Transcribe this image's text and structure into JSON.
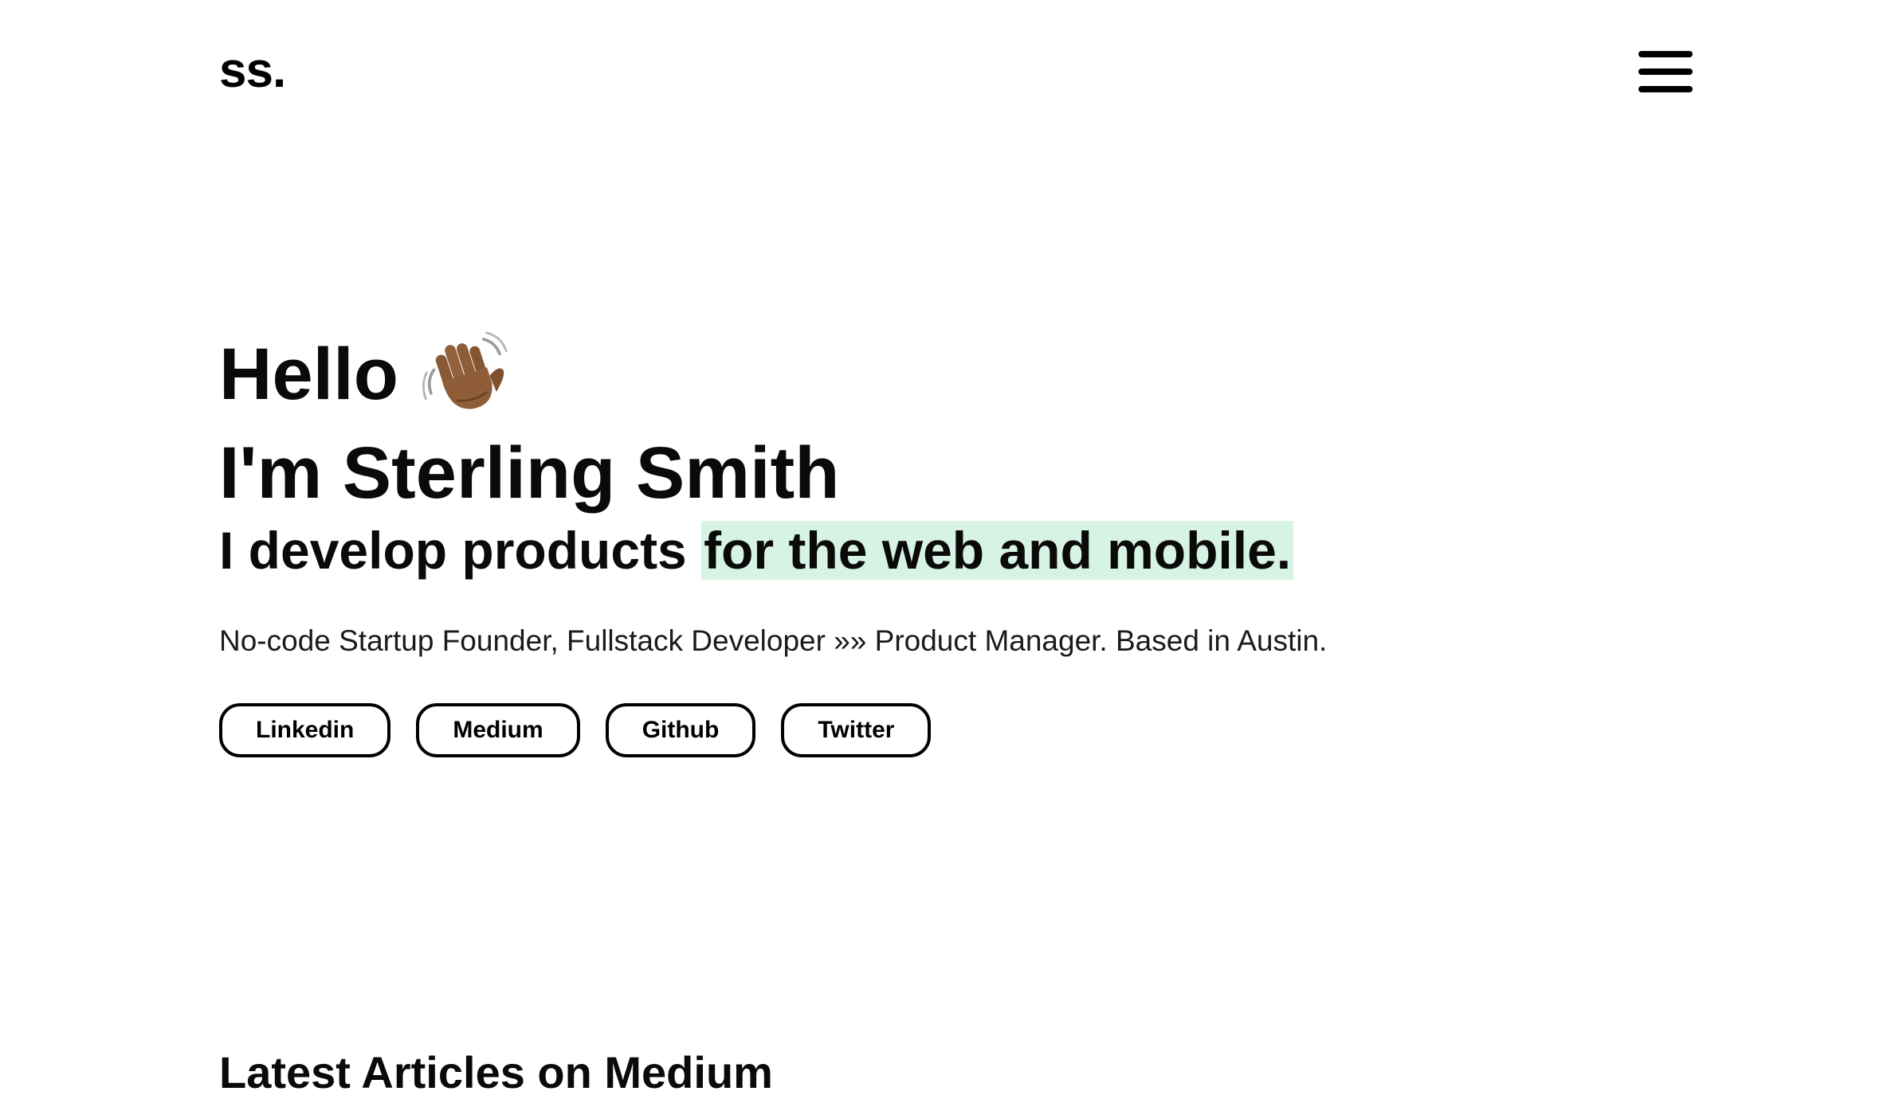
{
  "header": {
    "logo_text": "ss.",
    "menu_icon": "hamburger-menu-icon"
  },
  "hero": {
    "greeting": "Hello",
    "wave_icon": "waving-hand-icon",
    "name": "I'm Sterling Smith",
    "tagline_prefix": "I develop products ",
    "tagline_highlight": "for the web and mobile.",
    "highlight_color": "#d7f3e3",
    "bio": "No-code Startup Founder, Fullstack Developer »» Product Manager. Based in Austin."
  },
  "socials": [
    {
      "label": "Linkedin"
    },
    {
      "label": "Medium"
    },
    {
      "label": "Github"
    },
    {
      "label": "Twitter"
    }
  ],
  "articles": {
    "section_title": "Latest Articles on Medium"
  }
}
